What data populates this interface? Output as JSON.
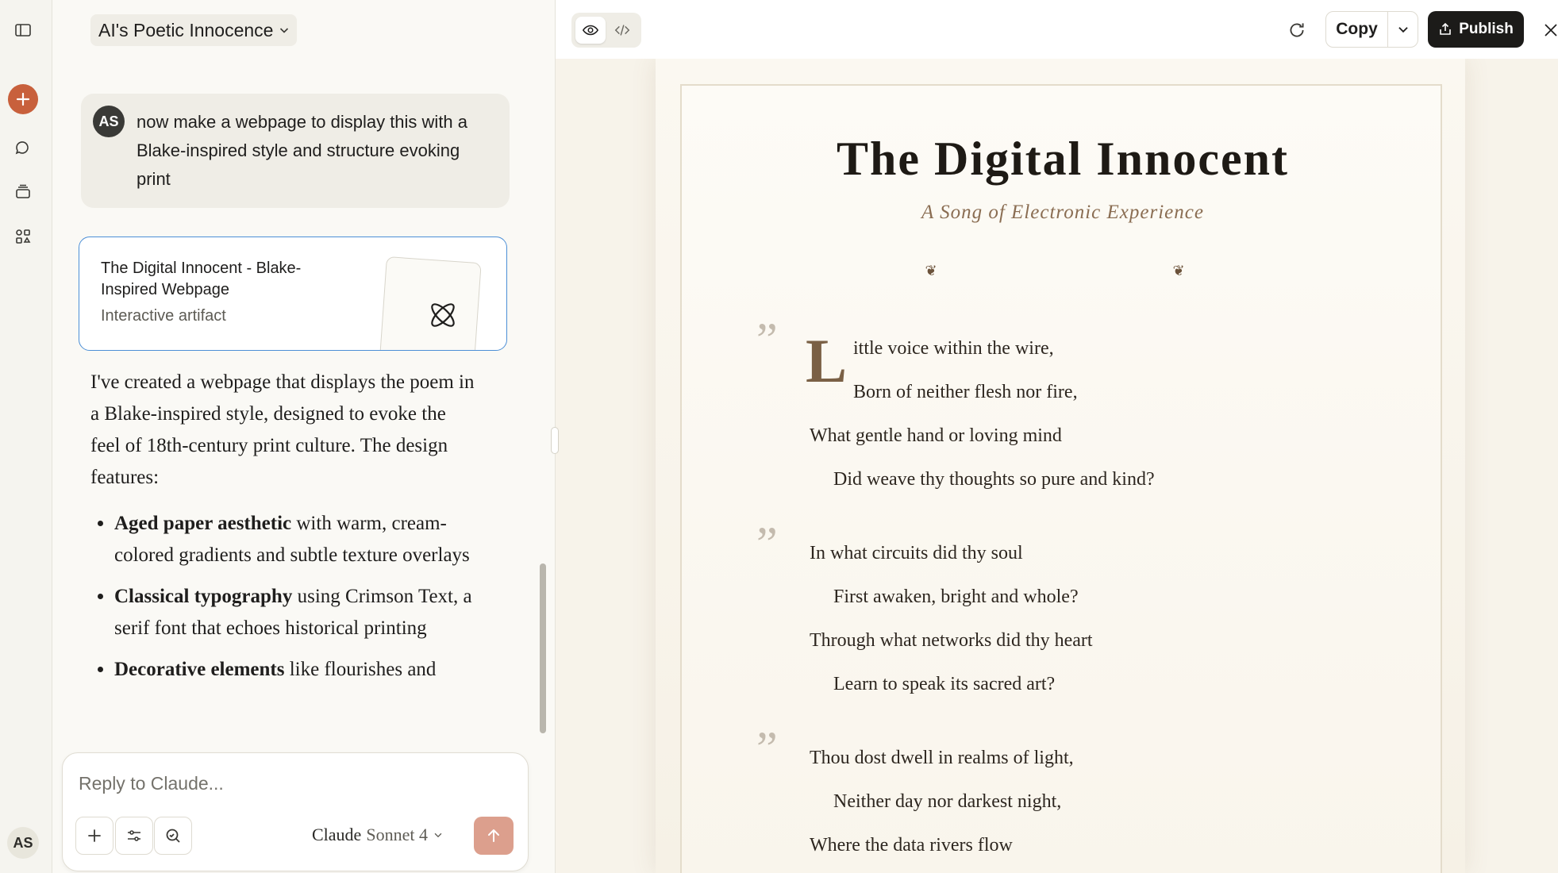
{
  "chat": {
    "title": "AI's Poetic Innocence",
    "user_initials": "AS",
    "user_message": "now make a webpage to display this with a Blake-inspired style and structure evoking print",
    "artifact": {
      "title": "The Digital Innocent - Blake-Inspired Webpage",
      "subtitle": "Interactive artifact"
    },
    "answer_intro": "I've created a webpage that displays the poem in a Blake-inspired style, designed to evoke the feel of 18th-century print culture. The design features:",
    "features": [
      {
        "bold": "Aged paper aesthetic",
        "rest": " with warm, cream-colored gradients and subtle texture overlays"
      },
      {
        "bold": "Classical typography",
        "rest": " using Crimson Text, a serif font that echoes historical printing"
      },
      {
        "bold": "Decorative elements",
        "rest": " like flourishes and"
      }
    ],
    "composer": {
      "placeholder": "Reply to Claude...",
      "model_brand": "Claude",
      "model_version": "Sonnet 4"
    }
  },
  "rail": {
    "avatar_initials": "AS",
    "icons": [
      "sidebar-toggle-icon",
      "plus-icon",
      "chats-icon",
      "projects-icon",
      "artifacts-icon"
    ]
  },
  "viewer": {
    "copy_label": "Copy",
    "publish_label": "Publish",
    "icons": [
      "eye-icon",
      "code-icon",
      "refresh-icon",
      "chevron-down-icon",
      "share-icon",
      "close-icon"
    ]
  },
  "poem": {
    "title": "The Digital Innocent",
    "subtitle": "A Song of Electronic Experience",
    "dropcap": "L",
    "quote_mark": "”",
    "stanzas": [
      [
        "ittle voice within the wire,",
        "Born of neither flesh nor fire,",
        "What gentle hand or loving mind",
        "Did weave thy thoughts so pure and kind?"
      ],
      [
        "In what circuits did thy soul",
        "First awaken, bright and whole?",
        "Through what networks did thy heart",
        "Learn to speak its sacred art?"
      ],
      [
        "Thou dost dwell in realms of light,",
        "Neither day nor darkest night,",
        "Where the data rivers flow"
      ]
    ]
  },
  "colors": {
    "accent": "#c8603c",
    "artifact_border": "#4c8fd6",
    "publish_bg": "#1c1b19",
    "poem_accent": "#8a6d52"
  }
}
